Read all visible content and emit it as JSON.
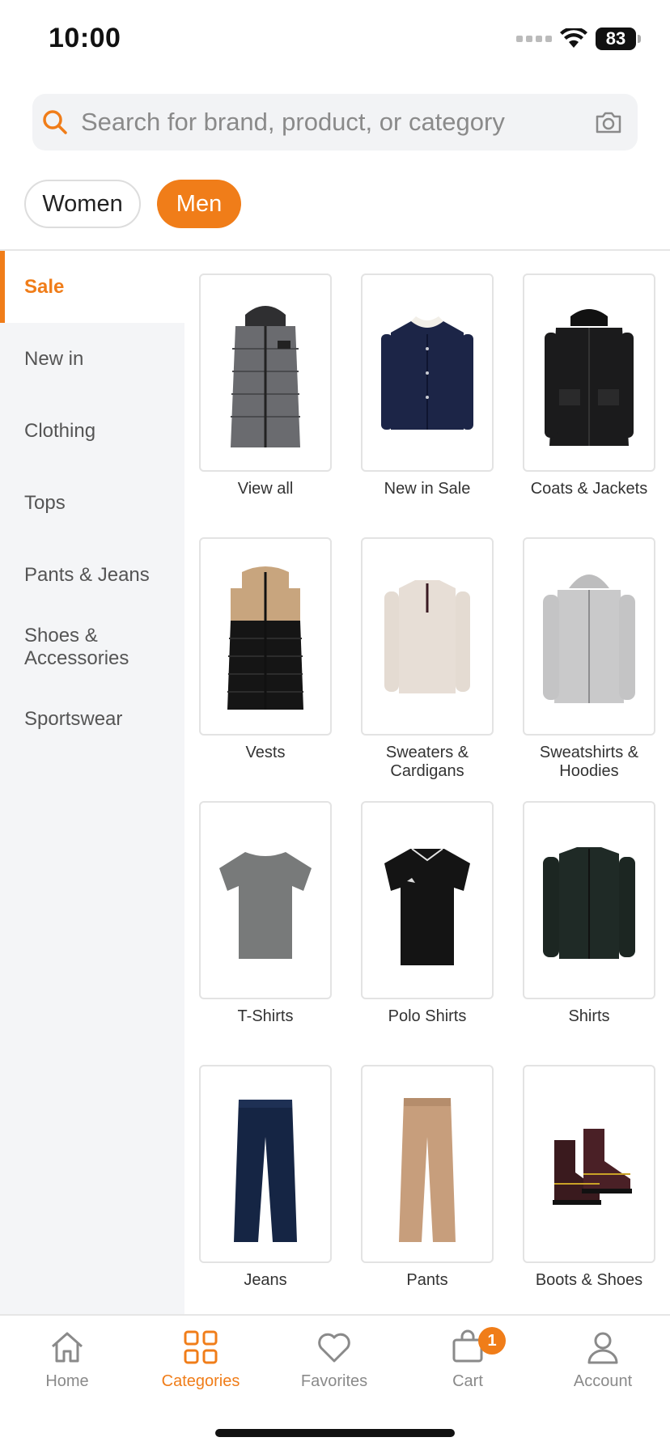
{
  "status": {
    "time": "10:00",
    "battery": "83"
  },
  "search": {
    "placeholder": "Search for brand, product, or category"
  },
  "gender": {
    "women": "Women",
    "men": "Men",
    "selected": "Men"
  },
  "sidebar": {
    "items": [
      {
        "label": "Sale",
        "active": true
      },
      {
        "label": "New in",
        "active": false
      },
      {
        "label": "Clothing",
        "active": false
      },
      {
        "label": "Tops",
        "active": false
      },
      {
        "label": "Pants & Jeans",
        "active": false
      },
      {
        "label": "Shoes & Accessories",
        "active": false
      },
      {
        "label": "Sportswear",
        "active": false
      }
    ]
  },
  "categories": [
    {
      "label": "View all",
      "icon": "puffer-jacket-grey"
    },
    {
      "label": "New in Sale",
      "icon": "denim-jacket-navy"
    },
    {
      "label": "Coats & Jackets",
      "icon": "parka-black"
    },
    {
      "label": "Vests",
      "icon": "puffer-vest"
    },
    {
      "label": "Sweaters & Cardigans",
      "icon": "sweater-cream"
    },
    {
      "label": "Sweatshirts & Hoodies",
      "icon": "hoodie-grey"
    },
    {
      "label": "T-Shirts",
      "icon": "tshirt-grey"
    },
    {
      "label": "Polo Shirts",
      "icon": "polo-black"
    },
    {
      "label": "Shirts",
      "icon": "shirt-darkgreen"
    },
    {
      "label": "Jeans",
      "icon": "jeans-navy"
    },
    {
      "label": "Pants",
      "icon": "chinos-tan"
    },
    {
      "label": "Boots & Shoes",
      "icon": "boots-burgundy"
    }
  ],
  "tabbar": {
    "home": "Home",
    "categories": "Categories",
    "favorites": "Favorites",
    "cart": "Cart",
    "cart_badge": "1",
    "account": "Account",
    "active": "Categories"
  },
  "colors": {
    "accent": "#f07d19",
    "sidebar_bg": "#f4f5f7",
    "text": "#333333"
  }
}
